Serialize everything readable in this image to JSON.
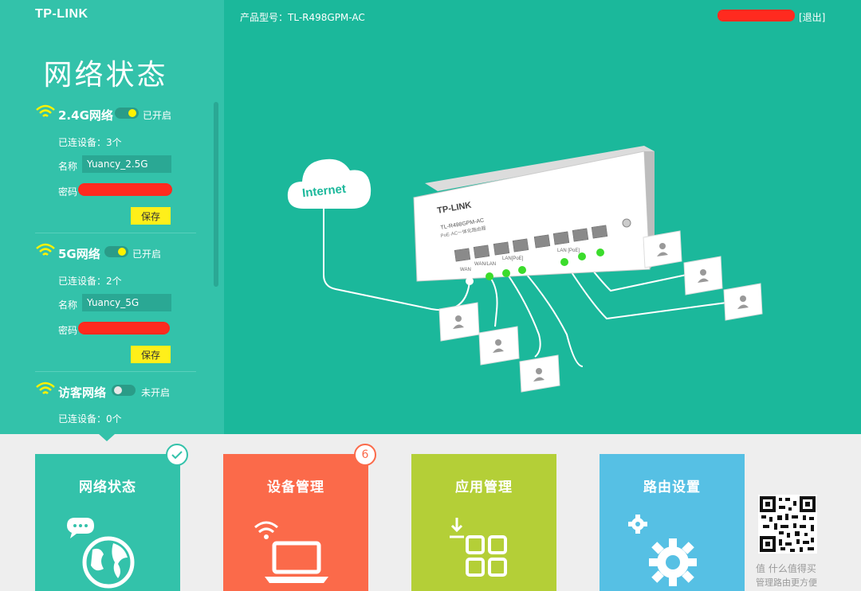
{
  "header": {
    "logo": "TP-LINK",
    "model_label": "产品型号：",
    "model_value": "TL-R498GPM-AC",
    "logout": "[退出]"
  },
  "status_panel": {
    "title": "网络状态",
    "networks": [
      {
        "name": "2.4G网络",
        "state": "已开启",
        "enabled": true,
        "devices_label": "已连设备：",
        "devices_count": "3个",
        "ssid_label": "名称",
        "ssid": "Yuancy_2.5G",
        "password_label": "密码",
        "save_label": "保存"
      },
      {
        "name": "5G网络",
        "state": "已开启",
        "enabled": true,
        "devices_label": "已连设备：",
        "devices_count": "2个",
        "ssid_label": "名称",
        "ssid": "Yuancy_5G",
        "password_label": "密码",
        "save_label": "保存"
      },
      {
        "name": "访客网络",
        "state": "未开启",
        "enabled": false,
        "devices_label": "已连设备：",
        "devices_count": "0个"
      }
    ]
  },
  "diagram": {
    "cloud_label": "Internet",
    "device_brand": "TP-LINK",
    "device_model": "TL-R498GPM-AC",
    "device_subtitle": "PoE·AC一体化路由器",
    "port_labels": [
      "WAN",
      "WAN/LAN",
      "LAN[PoE]",
      "LAN [PoE]"
    ]
  },
  "tiles": [
    {
      "title": "网络状态",
      "color": "#33c2aa",
      "icon": "globe-chat-icon",
      "badge": "check"
    },
    {
      "title": "设备管理",
      "color": "#fb6a4a",
      "icon": "laptop-wifi-icon",
      "badge": "6"
    },
    {
      "title": "应用管理",
      "color": "#b4cf37",
      "icon": "apps-grid-icon"
    },
    {
      "title": "路由设置",
      "color": "#56c0e4",
      "icon": "gears-icon"
    }
  ],
  "watermark": {
    "line1": "值 什么值得买",
    "line2": "管理路由更方便"
  },
  "colors": {
    "accent": "#33c2aa",
    "main_bg": "#1bb89b",
    "toggle_on": "#fff200",
    "save_btn": "#ffef1a",
    "link_dot": "#3bdc2c"
  }
}
